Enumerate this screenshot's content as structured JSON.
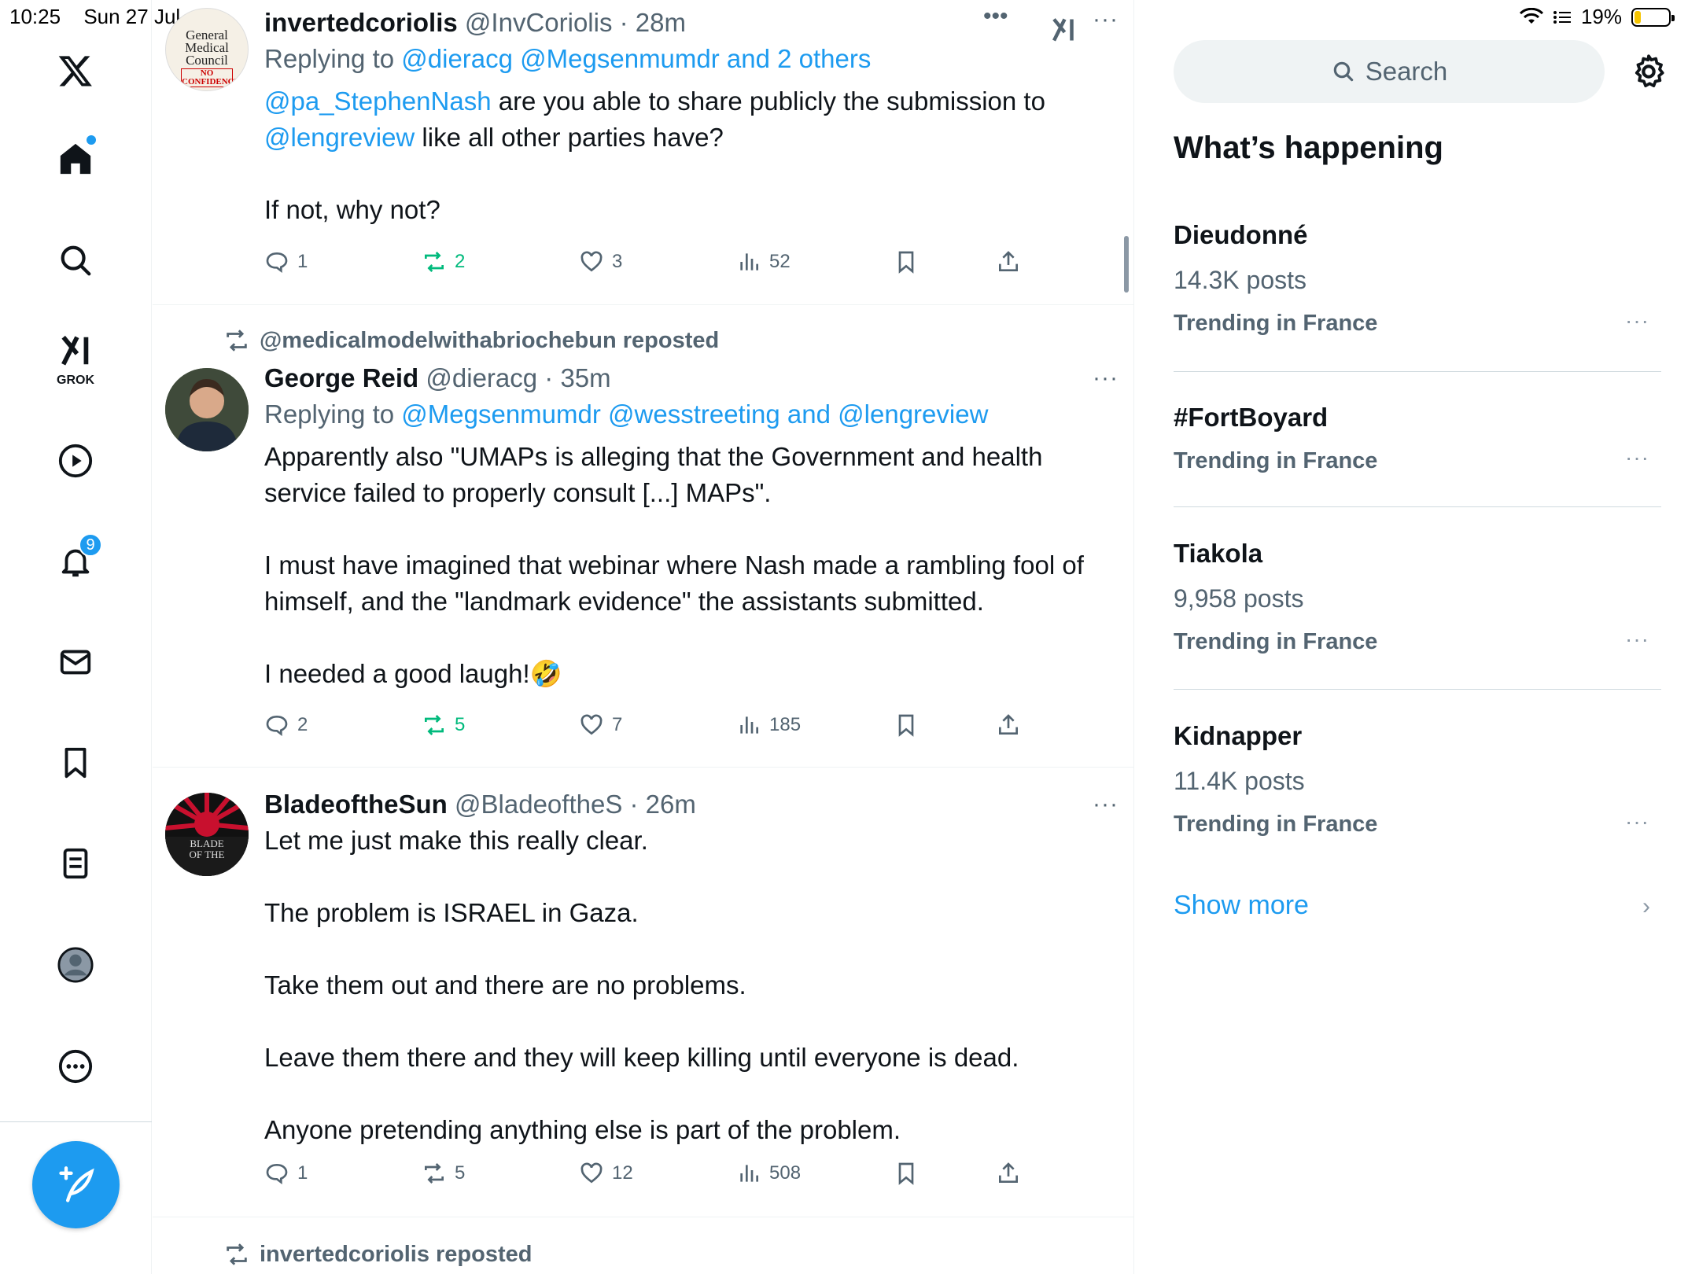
{
  "status": {
    "time": "10:25",
    "date": "Sun 27 Jul",
    "battery": "19%",
    "battery_fraction": 0.19
  },
  "nav": {
    "items": [
      "x-logo",
      "home",
      "explore",
      "grok",
      "video",
      "notifications",
      "messages",
      "bookmarks",
      "lists",
      "profile",
      "more"
    ],
    "grok_label": "GROK",
    "notifications_badge": "9"
  },
  "tweets": [
    {
      "name": "invertedcoriolis",
      "handle": "@InvCoriolis",
      "time": "28m",
      "reply_prefix": "Replying to ",
      "reply_to": "@dieracg @Megsenmumdr and 2 others",
      "mention1": "@pa_StephenNash",
      "text1": " are you able to share publicly the submission to",
      "mention2": "@lengreview",
      "text2": " like all other parties have?\n\nIf not, why not?",
      "avatar_text": {
        "l1": "General",
        "l2": "Medical",
        "l3": "Council",
        "l4": "NO",
        "l5": "CONFIDENCE"
      },
      "replies": "1",
      "reposts": "2",
      "likes": "3",
      "views": "52"
    },
    {
      "repost_by": "@medicalmodelwithabriochebun reposted",
      "name": "George Reid",
      "handle": "@dieracg",
      "time": "35m",
      "reply_prefix": "Replying to ",
      "reply_to": "@Megsenmumdr @wesstreeting and @lengreview",
      "text": "Apparently also \"UMAPs is alleging that the Government and health service failed to properly consult [...] MAPs\".\n\nI must have imagined that webinar where Nash made a rambling fool of himself, and the \"landmark evidence\" the assistants submitted.\n\nI needed a good laugh!🤣",
      "replies": "2",
      "reposts": "5",
      "likes": "7",
      "views": "185"
    },
    {
      "name": "BladeoftheSun",
      "handle": "@BladeoftheS",
      "time": "26m",
      "text": "Let me just make this really clear.\n\nThe problem is ISRAEL in Gaza.\n\nTake them out and there are no problems.\n\nLeave them there and they will keep killing until everyone is dead.\n\nAnyone pretending anything else is part of the problem.",
      "avatar_text": {
        "l1": "BLADE",
        "l2": "OF THE"
      },
      "replies": "1",
      "reposts": "5",
      "likes": "12",
      "views": "508"
    },
    {
      "repost_by": "invertedcoriolis reposted"
    }
  ],
  "right": {
    "search_placeholder": "Search",
    "heading": "What’s happening",
    "trends": [
      {
        "title": "Dieudonné",
        "posts": "14.3K posts",
        "location": "Trending in France"
      },
      {
        "title": "#FortBoyard",
        "posts": "",
        "location": "Trending in France"
      },
      {
        "title": "Tiakola",
        "posts": "9,958 posts",
        "location": "Trending in France"
      },
      {
        "title": "Kidnapper",
        "posts": "11.4K posts",
        "location": "Trending in France"
      }
    ],
    "show_more": "Show more"
  },
  "colors": {
    "accent": "#1d9bf0",
    "repost_green": "#00ba7c",
    "secondary_text": "#536471"
  }
}
